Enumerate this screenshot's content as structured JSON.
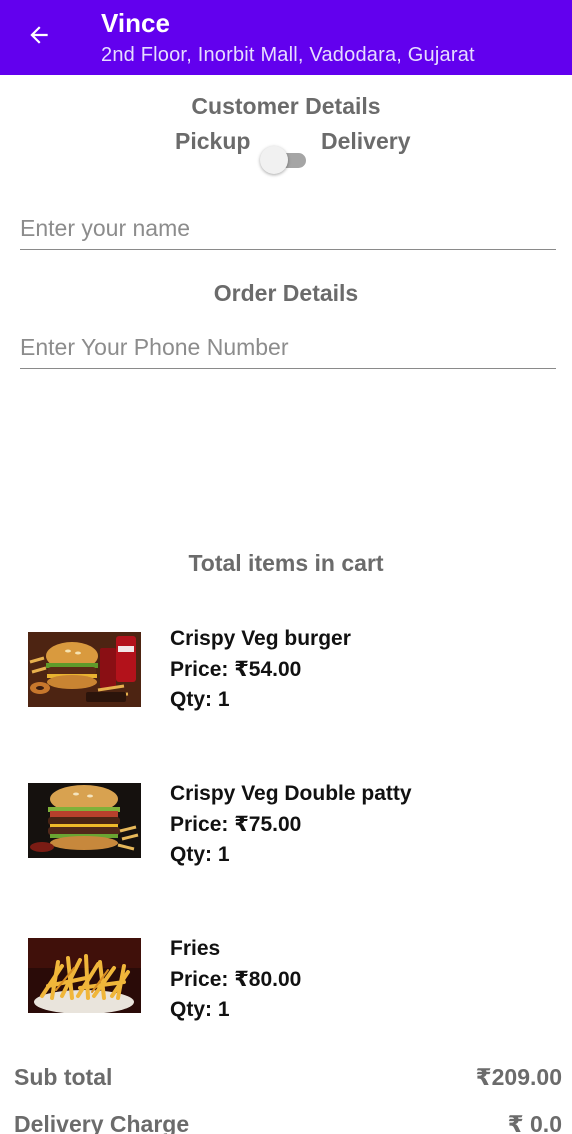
{
  "header": {
    "title": "Vince",
    "subtitle": "2nd Floor, Inorbit Mall, Vadodara, Gujarat",
    "back_icon": "arrow-left-icon",
    "background_color": "#6200ee"
  },
  "customer": {
    "heading": "Customer Details",
    "toggle_left_label": "Pickup",
    "toggle_right_label": "Delivery",
    "toggle_checked": false,
    "name_placeholder": "Enter your name",
    "name_value": ""
  },
  "order": {
    "heading": "Order Details",
    "phone_placeholder": "Enter Your Phone Number",
    "phone_value": ""
  },
  "cart": {
    "heading": "Total items in cart",
    "items": [
      {
        "name": "Crispy Veg burger",
        "price": "Price: ₹54.00",
        "qty": "Qty: 1",
        "image": "burger-with-fries-and-cola-image"
      },
      {
        "name": "Crispy Veg Double patty",
        "price": "Price: ₹75.00",
        "qty": "Qty: 1",
        "image": "double-patty-burger-image"
      },
      {
        "name": "Fries",
        "price": "Price: ₹80.00",
        "qty": "Qty: 1",
        "image": "french-fries-bowl-image"
      }
    ]
  },
  "summary": {
    "subtotal_label": "Sub total",
    "subtotal_value": "₹209.00",
    "delivery_label": "Delivery Charge",
    "delivery_value": "₹ 0.0"
  }
}
